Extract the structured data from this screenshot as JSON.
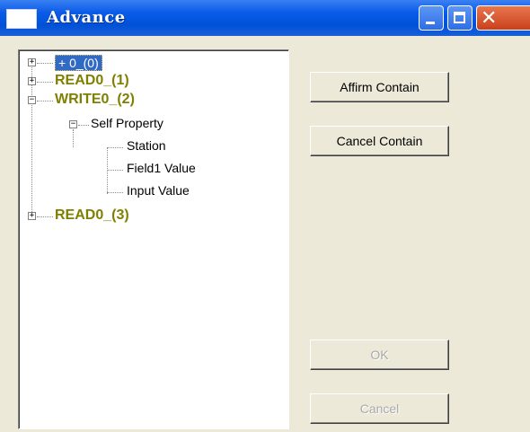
{
  "window": {
    "title": "Advance"
  },
  "tree": {
    "nodes": [
      {
        "label": "+ 0_(0)"
      },
      {
        "label": "READ0_(1)"
      },
      {
        "label": "WRITE0_(2)"
      },
      {
        "label": "Self Property"
      },
      {
        "label": "Station"
      },
      {
        "label": "Field1 Value"
      },
      {
        "label": "Input Value"
      },
      {
        "label": "READ0_(3)"
      }
    ]
  },
  "buttons": {
    "affirm": "Affirm Contain",
    "cancel_contain": "Cancel Contain",
    "ok": "OK",
    "cancel": "Cancel"
  },
  "icons": {
    "window": "window-icon",
    "minimize": "minimize-icon",
    "maximize": "maximize-icon",
    "close": "close-icon"
  }
}
